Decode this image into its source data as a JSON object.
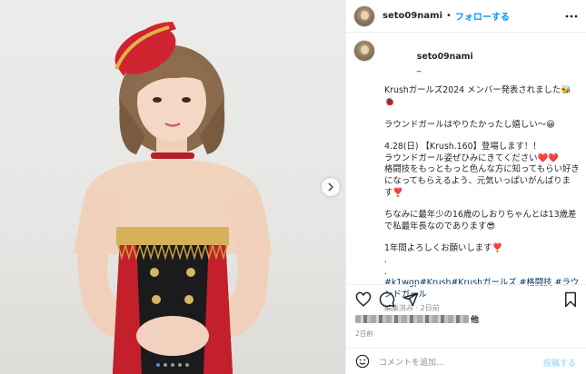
{
  "header": {
    "username": "seto09nami",
    "separator": "•",
    "follow_label": "フォローする",
    "more_icon": "more-horizontal-icon"
  },
  "caption": {
    "username": "seto09nami",
    "lines": [
      "_",
      "Krushガールズ2024 メンバー発表されました🐝",
      "🐞"
    ],
    "line_round": "ラウンドガールはやりたかったし嬉しい～😀",
    "line_event1": "4.28(日) 【Krush.160】登場します！！",
    "line_event2": "ラウンドガール姿ぜひみにきてください❤️❤️",
    "line_event3": "格闘技をもっともっと色んな方に知ってもらい好きになってもらえるよう、元気いっぱいがんばります❣️",
    "line_chinami1": "ちなみに最年少の16歳のしおりちゃんとは13歳差で私最年長なのであります😎",
    "line_year": "1年間よろしくお願いします❣️",
    "dot1": ".",
    "dot2": ".",
    "hashtags": "#k1wgp#Krush#Krushガールズ #格闘技 #ラウンドガール",
    "meta": "編集済み · 2日前"
  },
  "likes": {
    "suffix": "他"
  },
  "time": "2日前",
  "comment": {
    "placeholder": "コメントを追加...",
    "post_label": "投稿する",
    "emoji_icon": "smiley-icon"
  },
  "carousel": {
    "dot_count": 5,
    "active_index": 0
  },
  "colors": {
    "accent": "#0095f6",
    "hashtag": "#00376b",
    "muted": "#8e8e8e",
    "carousel_active": "#3897f0"
  }
}
